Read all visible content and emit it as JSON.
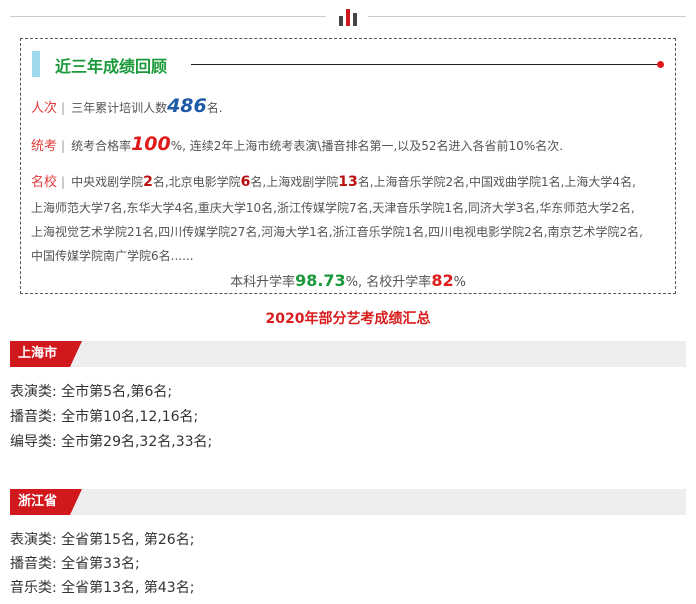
{
  "review": {
    "title": "近三年成绩回顾",
    "row1": {
      "label": "人次",
      "pre": "三年累计培训人数",
      "num": "486",
      "post": "名."
    },
    "row2": {
      "label": "统考",
      "pre": "统考合格率",
      "num": "100",
      "post": "%, 连续2年上海市统考表演\\播音排名第一,以及52名进入各省前10%名次."
    },
    "row3": {
      "label": "名校",
      "line1": [
        {
          "t": "中央戏剧学院"
        },
        {
          "n": "2"
        },
        {
          "t": "名,北京电影学院"
        },
        {
          "n": "6"
        },
        {
          "t": "名,上海戏剧学院"
        },
        {
          "n": "13"
        },
        {
          "t": "名,上海音乐学院2名,中国戏曲学院1名,上海大学4名,"
        }
      ],
      "line2": "上海师范大学7名,东华大学4名,重庆大学10名,浙江传媒学院7名,天津音乐学院1名,同济大学3名,华东师范大学2名,",
      "line3": "上海视觉艺术学院21名,四川传媒学院27名,河海大学1名,浙江音乐学院1名,四川电视电影学院2名,南京艺术学院2名,",
      "line4": "中国传媒学院南广学院6名......"
    },
    "summary": {
      "pre": "本科升学率",
      "rate1": "98.73",
      "mid": "%, 名校升学率",
      "rate2": "82",
      "post": "%"
    }
  },
  "section_title": "2020年部分艺考成绩汇总",
  "regions": [
    {
      "name": "上海市",
      "items": [
        "表演类: 全市第5名,第6名;",
        "播音类: 全市第10名,12,16名;",
        "编导类: 全市第29名,32名,33名;"
      ]
    },
    {
      "name": "浙江省",
      "items": [
        "表演类: 全省第15名, 第26名;",
        "播音类: 全省第33名;",
        "音乐类: 全省第13名, 第43名;"
      ]
    }
  ],
  "colors": {
    "accent_red": "#d0181d",
    "green": "#1a9a3a",
    "blue": "#1f5aa6",
    "light_blue": "#9fd8ea"
  }
}
